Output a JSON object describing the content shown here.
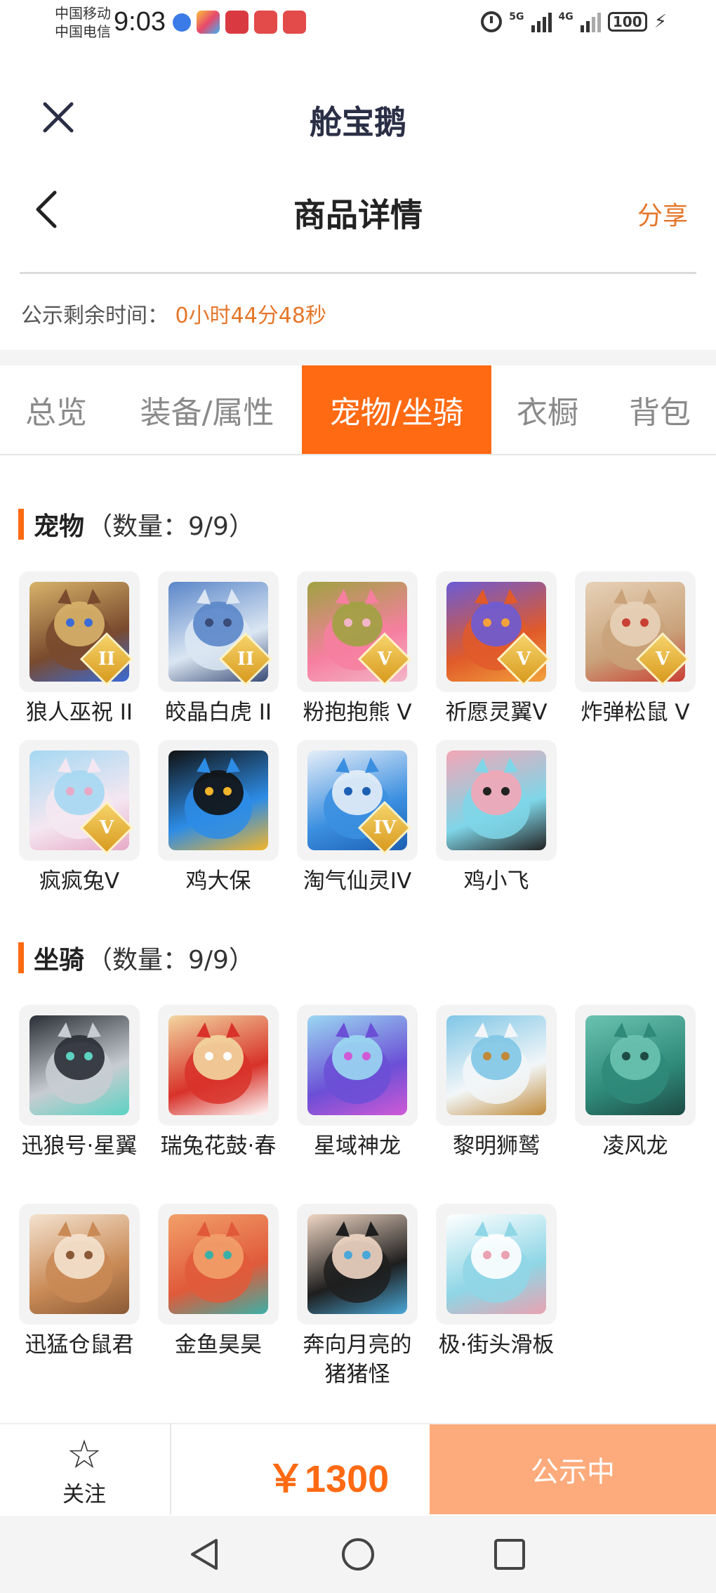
{
  "status_bar": {
    "carrier_1": "中国移动",
    "carrier_2": "中国电信",
    "time": "9:03",
    "network_1": "5G",
    "network_2": "4G",
    "battery": "100",
    "app_icons": [
      "app-shield-icon",
      "app-colorful-icon",
      "app-book-icon",
      "app-huawei-icon",
      "app-huawei-icon"
    ]
  },
  "app": {
    "title": "舱宝鹅"
  },
  "nav": {
    "title": "商品详情",
    "share": "分享"
  },
  "notice": {
    "label": "公示剩余时间：",
    "remaining": "0小时44分48秒"
  },
  "tabs": [
    {
      "label": "总览",
      "active": false
    },
    {
      "label": "装备/属性",
      "active": false
    },
    {
      "label": "宠物/坐骑",
      "active": true
    },
    {
      "label": "衣橱",
      "active": false
    },
    {
      "label": "背包",
      "active": false
    }
  ],
  "pets": {
    "title": "宠物",
    "count": "（数量：9/9）",
    "items": [
      {
        "name": "狼人巫祝 II",
        "badge": "II",
        "colors": [
          "#7a4a2e",
          "#d7b36a",
          "#3a6bd6"
        ]
      },
      {
        "name": "皎晶白虎 II",
        "badge": "II",
        "colors": [
          "#dbe6f2",
          "#5a86c9",
          "#3a4c78"
        ]
      },
      {
        "name": "粉抱抱熊 V",
        "badge": "V",
        "colors": [
          "#f67fa0",
          "#9fa241",
          "#f3b6c8"
        ]
      },
      {
        "name": "祈愿灵翼V",
        "badge": "V",
        "colors": [
          "#e05a2a",
          "#6b5bd6",
          "#f2a13c"
        ]
      },
      {
        "name": "炸弹松鼠 V",
        "badge": "V",
        "colors": [
          "#c9a27a",
          "#e7d2b8",
          "#c94034"
        ]
      },
      {
        "name": "疯疯兔V",
        "badge": "V",
        "colors": [
          "#f4e7f1",
          "#a5d8f2",
          "#e7a9c6"
        ]
      },
      {
        "name": "鸡大保",
        "badge": "",
        "colors": [
          "#2d8ce6",
          "#111111",
          "#f3b52a"
        ]
      },
      {
        "name": "淘气仙灵IV",
        "badge": "IV",
        "colors": [
          "#3b8fe0",
          "#e6eef8",
          "#1d5fb3"
        ]
      },
      {
        "name": "鸡小飞",
        "badge": "",
        "colors": [
          "#7fd6e8",
          "#f4a6b6",
          "#222222"
        ]
      }
    ]
  },
  "mounts": {
    "title": "坐骑",
    "count": "（数量：9/9）",
    "items": [
      {
        "name": "迅狼号·星翼",
        "colors": [
          "#c8ccd2",
          "#2a2e36",
          "#5cd2c2"
        ]
      },
      {
        "name": "瑞兔花鼓·春",
        "colors": [
          "#d8322a",
          "#f2d6a0",
          "#ffffff"
        ]
      },
      {
        "name": "星域神龙",
        "colors": [
          "#6b4fd6",
          "#9bd8f2",
          "#d05ad6"
        ]
      },
      {
        "name": "黎明狮鹫",
        "colors": [
          "#f2f6f8",
          "#7fc6e6",
          "#c08a3a"
        ]
      },
      {
        "name": "凌风龙",
        "colors": [
          "#2f8a7a",
          "#6bc2b0",
          "#1d4a44"
        ]
      },
      {
        "name": "迅猛仓鼠君",
        "colors": [
          "#c98a56",
          "#f4e2cf",
          "#8a5a36"
        ]
      },
      {
        "name": "金鱼昊昊",
        "colors": [
          "#e05a3a",
          "#f2a06a",
          "#3ab0a6"
        ]
      },
      {
        "name": "奔向月亮的猪猪怪",
        "colors": [
          "#1e1e1e",
          "#f0d6c4",
          "#4aa8d8"
        ]
      },
      {
        "name": "极·街头滑板",
        "colors": [
          "#8fd6e6",
          "#ffffff",
          "#e9a2b0"
        ]
      }
    ]
  },
  "bottom": {
    "follow": "关注",
    "price": "￥1300",
    "status_button": "公示中"
  },
  "colors": {
    "accent": "#ff6a13",
    "accent_light": "#fdab7c",
    "orange_text": "#e5772a"
  }
}
